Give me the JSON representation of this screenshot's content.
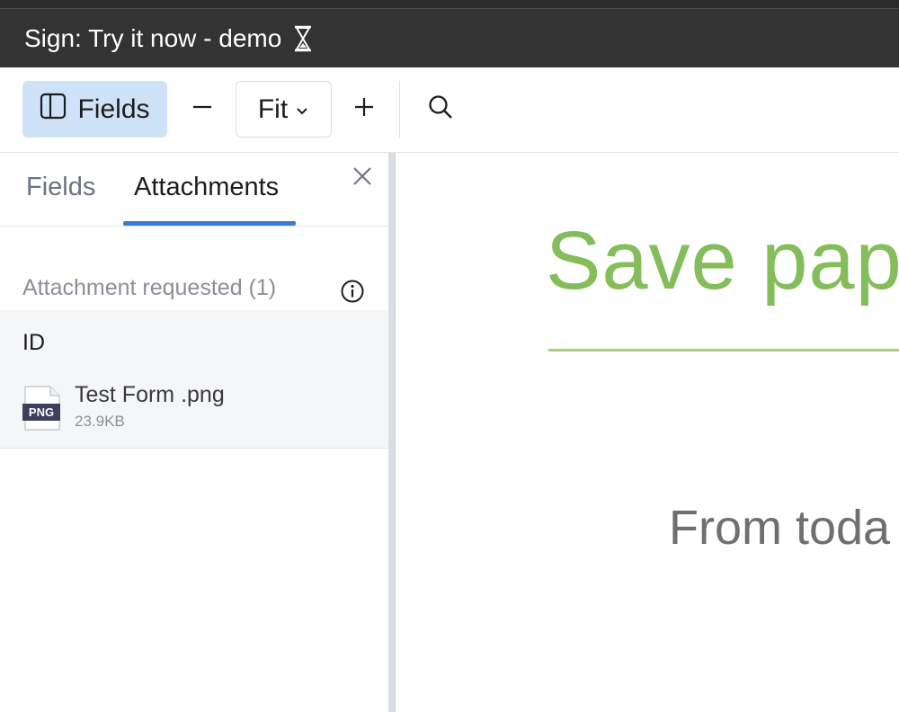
{
  "window": {
    "title": "Sign: Try it now - demo"
  },
  "toolbar": {
    "fields_label": "Fields",
    "zoom_label": "Fit",
    "accent_bg": "#cfe3f8"
  },
  "sidebar": {
    "tabs": [
      {
        "label": "Fields",
        "active": false
      },
      {
        "label": "Attachments",
        "active": true
      }
    ],
    "section_header": "Attachment requested (1)",
    "group": {
      "label": "ID",
      "files": [
        {
          "name": "Test Form .png",
          "size": "23.9KB",
          "badge": "PNG"
        }
      ]
    }
  },
  "document": {
    "heading": "Save pap",
    "subheading": "From toda",
    "heading_color": "#84bd5a"
  },
  "icons": {
    "title_status": "hourglass-icon",
    "sidebar_toggle": "sidebar-panel-icon",
    "zoom_out": "minus-icon",
    "zoom_dropdown": "chevron-down-icon",
    "zoom_in": "plus-icon",
    "search": "search-icon",
    "close": "close-icon",
    "info": "info-icon",
    "file": "png-file-icon"
  }
}
